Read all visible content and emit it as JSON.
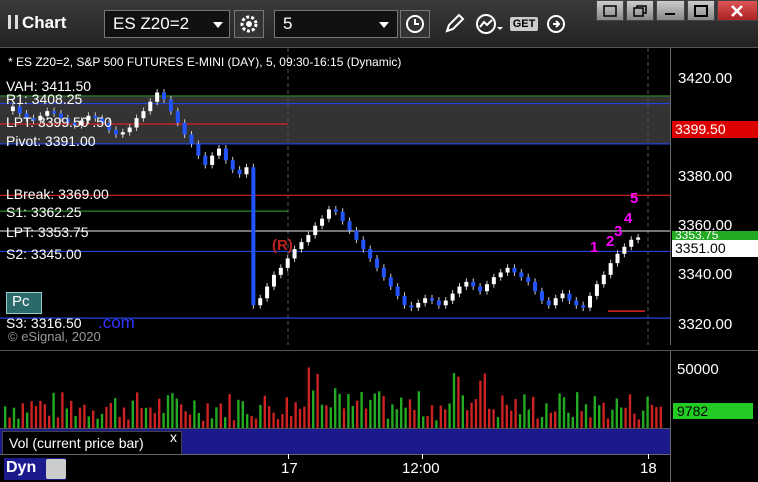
{
  "toolbar": {
    "app_title": "Chart",
    "symbol": "ES Z20=2",
    "interval": "5",
    "get_label": "GET"
  },
  "chart": {
    "header": "* ES Z20=2, S&P 500 FUTURES E-MINI (DAY), 5, 09:30-16:15 (Dynamic)",
    "copyright": "© eSignal, 2020",
    "watermark_suffix": ".com",
    "pc_button": "Pc",
    "reversal_mark": "(R)",
    "levels": [
      {
        "label": "VAH: 3411.50",
        "price": 3411.5,
        "color": "#2a8a2a"
      },
      {
        "label": "R1: 3408.25",
        "price": 3408.25,
        "color": "#2244dd"
      },
      {
        "label": "LPT: 3399.50 .50",
        "price": 3399.5,
        "color": "#dd2222"
      },
      {
        "label": "Pivot: 3391.00",
        "price": 3391.0,
        "color": "#2244dd"
      },
      {
        "label": "LBreak: 3369.00",
        "price": 3369.0,
        "color": "#dd2222"
      },
      {
        "label": "S1: 3362.25",
        "price": 3362.25,
        "color": "#2a8a2a"
      },
      {
        "label": "LPT: 3353.75",
        "price": 3353.75,
        "color": "#bbbbbb"
      },
      {
        "label": "S2: 3345.00",
        "price": 3345.0,
        "color": "#2244dd"
      },
      {
        "label": "S3: 3316.50",
        "price": 3316.5,
        "color": "#2244dd"
      }
    ],
    "counts": [
      "1",
      "2",
      "3",
      "4",
      "5"
    ],
    "price_axis": [
      "3420.00",
      "3400.00",
      "3380.00",
      "3360.00",
      "3340.00",
      "3320.00"
    ],
    "price_flags": [
      {
        "text": "3399.50",
        "bg": "#dd0000",
        "fg": "#ffffff"
      },
      {
        "text": "3353.75",
        "bg": "#22aa22",
        "fg": "#ffffff"
      },
      {
        "text": "3351.00",
        "bg": "#ffffff",
        "fg": "#000000"
      }
    ]
  },
  "volume": {
    "label": "Vol (current price bar)",
    "close_x": "x",
    "axis_label": "50000",
    "current_value": "9782"
  },
  "time_axis": {
    "labels": [
      "17",
      "12:00",
      "18"
    ],
    "dyn_label": "Dyn"
  },
  "chart_data": {
    "type": "candlestick",
    "title": "* ES Z20=2, S&P 500 FUTURES E-MINI (DAY), 5, 09:30-16:15 (Dynamic)",
    "ylim": [
      3305,
      3432
    ],
    "x_ticks": [
      "17",
      "12:00",
      "18"
    ],
    "y_ticks": [
      3420,
      3400,
      3380,
      3360,
      3340,
      3320
    ],
    "last_price": 3351.0,
    "volume_last": 9782,
    "volume_tick": 50000
  }
}
